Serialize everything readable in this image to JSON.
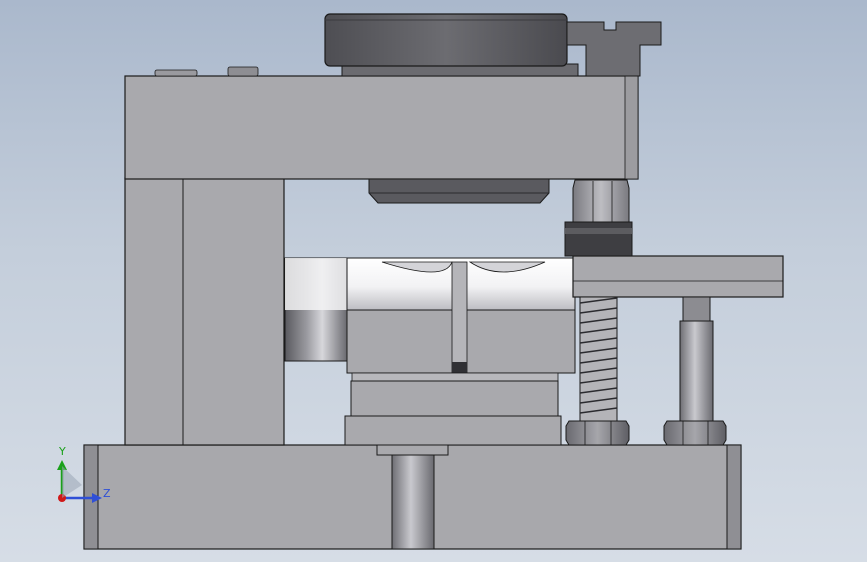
{
  "viewport": {
    "background_top": "#aab8cc",
    "background_bottom": "#d6dde6"
  },
  "triad": {
    "y_label": "Y",
    "z_label": "Z",
    "y_color": "#1aa11a",
    "z_color": "#2f4fd6",
    "x_color": "#d01818"
  },
  "model": {
    "part_color": "#a9a9ad",
    "dark_part_color": "#5f5f63",
    "edge_color": "#1a1a1a"
  }
}
